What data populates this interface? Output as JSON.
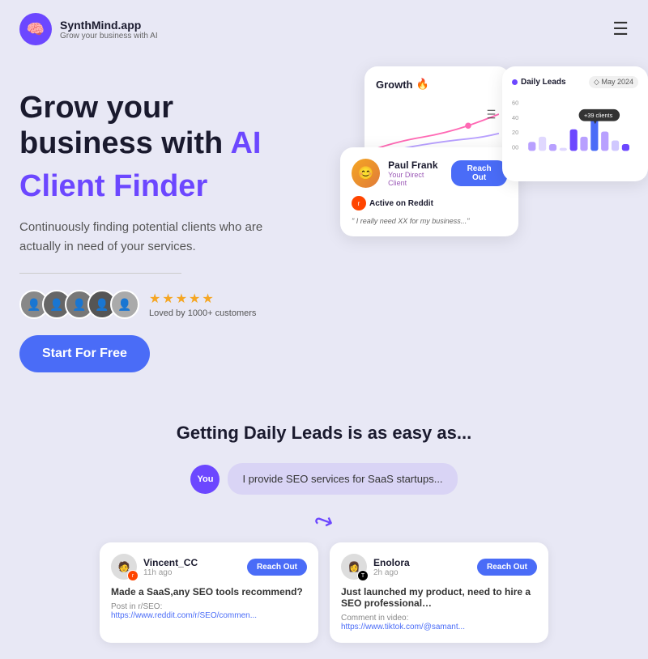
{
  "header": {
    "logo_name": "SynthMind.app",
    "logo_tagline": "Grow your business with AI",
    "menu_icon": "☰"
  },
  "hero": {
    "title_line1": "Grow your",
    "title_line2": "business with",
    "title_ai": "AI",
    "title_line3": "Client Finder",
    "description": "Continuously finding potential clients who are actually in need of your services.",
    "stars": "★★★★★",
    "loved_text": "Loved by 1000+ customers",
    "cta_label": "Start For Free"
  },
  "growth_card": {
    "title": "Growth",
    "icon": "🔥"
  },
  "paul_card": {
    "name": "Paul Frank",
    "subtitle": "Your Direct Client",
    "reach_label": "Reach Out",
    "platform": "Active on Reddit",
    "quote": "\" I really need XX for my business...\""
  },
  "leads_card": {
    "title": "Daily Leads",
    "date": "◇ May 2024",
    "tooltip": "+39 clients",
    "y_labels": [
      "60",
      "40",
      "20",
      "00"
    ]
  },
  "bottom_section": {
    "title": "Getting Daily Leads is as easy as...",
    "you_label": "You",
    "chat_text": "I provide SEO services for SaaS startups...",
    "leads": [
      {
        "name": "Vincent_CC",
        "time": "11h ago",
        "reach_label": "Reach Out",
        "text": "Made a SaaS,any SEO tools recommend?",
        "link_label": "Post in r/SEO:",
        "link": "https://www.reddit.com/r/SEO/commen...",
        "platform": "reddit"
      },
      {
        "name": "Enolora",
        "time": "2h ago",
        "reach_label": "Reach Out",
        "text": "Just launched my product, need to hire a SEO professional…",
        "link_label": "Comment in video:",
        "link": "https://www.tiktok.com/@samant...",
        "platform": "tiktok"
      }
    ]
  }
}
